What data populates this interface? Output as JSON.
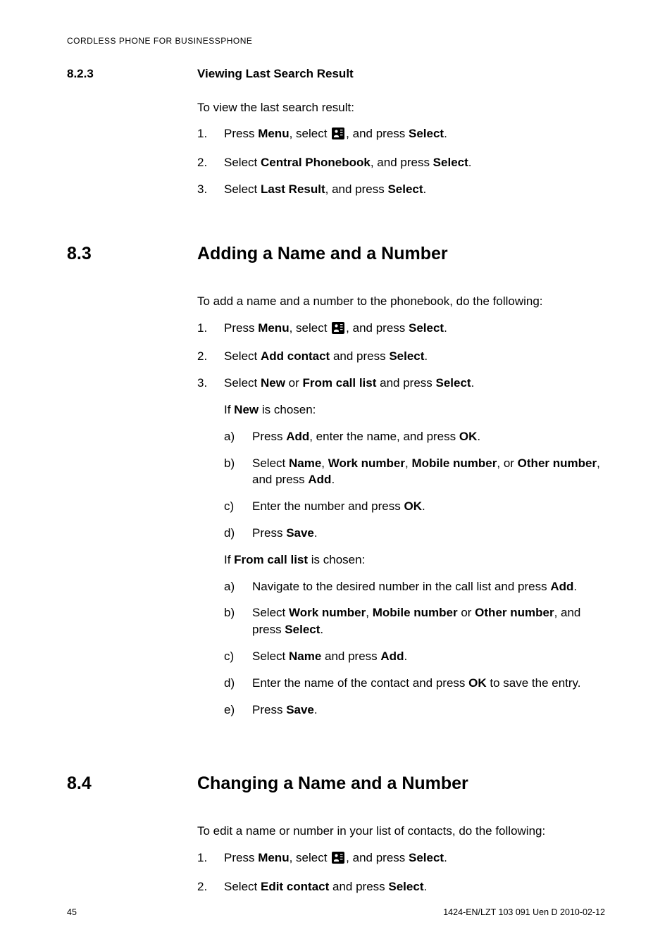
{
  "runningHeader": "CORDLESS PHONE FOR BUSINESSPHONE",
  "footer": {
    "left": "45",
    "right": "1424-EN/LZT 103 091 Uen D 2010-02-12"
  },
  "s823": {
    "num": "8.2.3",
    "title": "Viewing Last Search Result",
    "intro": "To view the last search result:",
    "steps": {
      "s1a": "Press ",
      "s1b": "Menu",
      "s1c": ", select ",
      "s1d": ", and press ",
      "s1e": "Select",
      "s1f": ".",
      "s2a": "Select ",
      "s2b": "Central Phonebook",
      "s2c": ", and press ",
      "s2d": "Select",
      "s2e": ".",
      "s3a": "Select ",
      "s3b": "Last Result",
      "s3c": ", and press ",
      "s3d": "Select",
      "s3e": "."
    }
  },
  "s83": {
    "num": "8.3",
    "title": "Adding a Name and a Number",
    "intro": "To add a name and a number to the phonebook, do the following:",
    "steps": {
      "s1a": "Press ",
      "s1b": "Menu",
      "s1c": ", select ",
      "s1d": ", and press ",
      "s1e": "Select",
      "s1f": ".",
      "s2a": "Select ",
      "s2b": "Add contact",
      "s2c": " and press ",
      "s2d": "Select",
      "s2e": ".",
      "s3a": "Select ",
      "s3b": "New",
      "s3c": " or ",
      "s3d": "From call list",
      "s3e": " and press ",
      "s3f": "Select",
      "s3g": ".",
      "ifnew_a": "If ",
      "ifnew_b": "New",
      "ifnew_c": " is chosen:",
      "new_a_a": "Press ",
      "new_a_b": "Add",
      "new_a_c": ", enter the name, and press ",
      "new_a_d": "OK",
      "new_a_e": ".",
      "new_b_a": "Select ",
      "new_b_b": "Name",
      "new_b_c": ", ",
      "new_b_d": "Work number",
      "new_b_e": ", ",
      "new_b_f": "Mobile number",
      "new_b_g": ", or ",
      "new_b_h": "Other number",
      "new_b_i": ", and press ",
      "new_b_j": "Add",
      "new_b_k": ".",
      "new_c_a": "Enter the number and press ",
      "new_c_b": "OK",
      "new_c_c": ".",
      "new_d_a": "Press ",
      "new_d_b": "Save",
      "new_d_c": ".",
      "ifcall_a": "If ",
      "ifcall_b": "From call list",
      "ifcall_c": " is chosen:",
      "call_a_a": "Navigate to the desired number in the call list and press ",
      "call_a_b": "Add",
      "call_a_c": ".",
      "call_b_a": "Select ",
      "call_b_b": "Work number",
      "call_b_c": ", ",
      "call_b_d": "Mobile number",
      "call_b_e": " or ",
      "call_b_f": "Other number",
      "call_b_g": ", and press ",
      "call_b_h": "Select",
      "call_b_i": ".",
      "call_c_a": "Select ",
      "call_c_b": "Name",
      "call_c_c": " and press ",
      "call_c_d": "Add",
      "call_c_e": ".",
      "call_d_a": "Enter the name of the contact and press ",
      "call_d_b": "OK",
      "call_d_c": " to save the entry.",
      "call_e_a": "Press ",
      "call_e_b": "Save",
      "call_e_c": "."
    }
  },
  "s84": {
    "num": "8.4",
    "title": "Changing a Name and a Number",
    "intro": "To edit a name or number in your list of contacts, do the following:",
    "steps": {
      "s1a": "Press ",
      "s1b": "Menu",
      "s1c": ", select ",
      "s1d": ", and press ",
      "s1e": "Select",
      "s1f": ".",
      "s2a": "Select ",
      "s2b": "Edit contact",
      "s2c": " and press ",
      "s2d": "Select",
      "s2e": "."
    }
  },
  "markers": {
    "n1": "1.",
    "n2": "2.",
    "n3": "3.",
    "a": "a)",
    "b": "b)",
    "c": "c)",
    "d": "d)",
    "e": "e)"
  }
}
